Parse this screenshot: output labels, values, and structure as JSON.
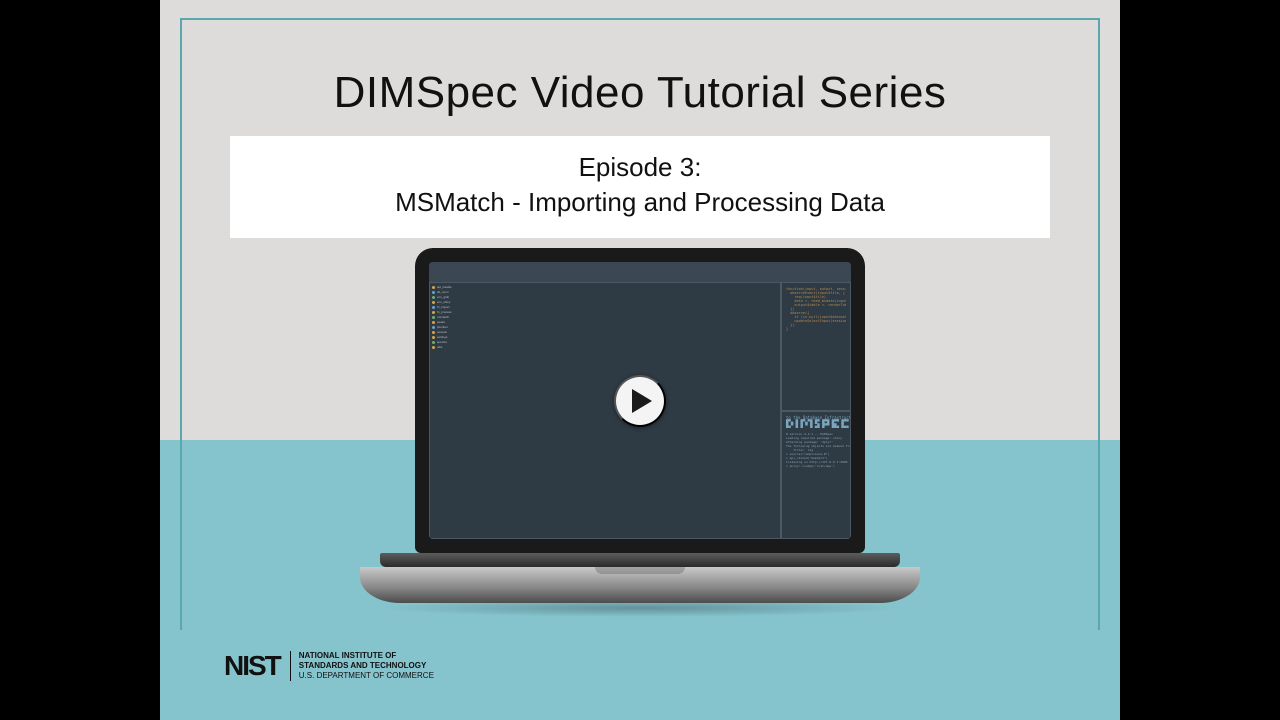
{
  "title": "DIMSpec Video Tutorial Series",
  "subtitle": {
    "line1": "Episode 3:",
    "line2": "MSMatch - Importing and Processing Data"
  },
  "laptop": {
    "console_header": "to the Database Infrastructure for Mass Spectrometry (DIMSpec) Project.",
    "code_snippet": "function(input, output, session) {\n  observeEvent(input$file, {\n    req(input$file)\n    data <- read_msdata(input$file$datapath)\n    output$table <- renderTable(data)\n  })\n  observe({\n    if (is.null(input$dataset)) return()\n    updateSelectInput(session, \"column\")\n  })\n}",
    "console_blur": "R version 4.2.1 -- DIMSpec\nLoading required package: shiny\nAttaching package: 'dplyr'\nThe following objects are masked from 'package:stats':\n    filter, lag\n> source(\"compliance.R\")\n> api_reload(\"msmatch\")\nListening on http://127.0.0.1:4000\n> shiny::runApp('inst/app')",
    "sidebar_items": [
      "api_handle",
      "db_conn",
      "env_glob",
      "env_shiny",
      "fn_import",
      "fn_process",
      "msmatch",
      "peaks",
      "plumber",
      "session",
      "settings",
      "spectra",
      "utils"
    ]
  },
  "play_button_label": "Play video",
  "logo": {
    "mark": "NIST",
    "line1": "NATIONAL INSTITUTE OF",
    "line2": "STANDARDS AND TECHNOLOGY",
    "line3": "U.S. DEPARTMENT OF COMMERCE"
  }
}
